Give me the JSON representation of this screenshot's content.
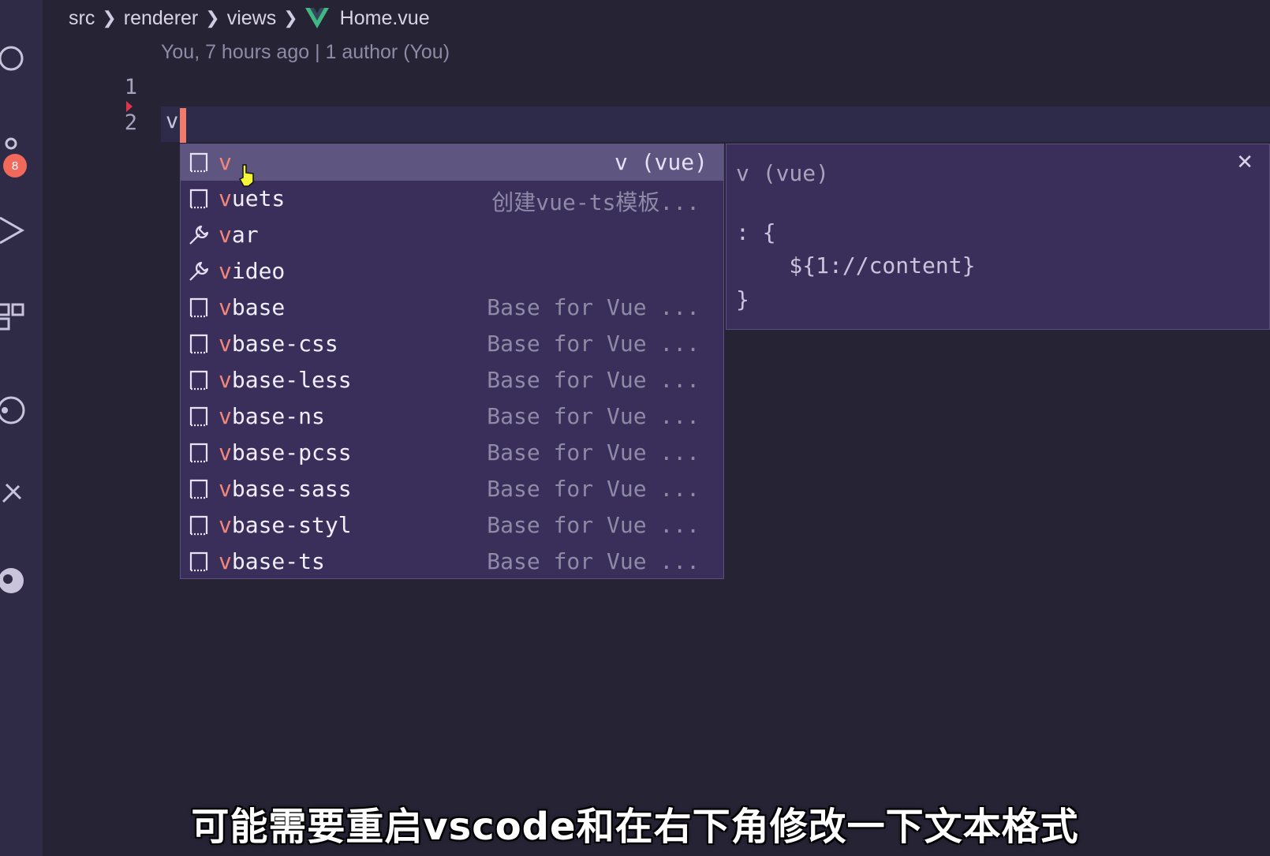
{
  "breadcrumb": {
    "items": [
      "src",
      "renderer",
      "views"
    ],
    "file": "Home.vue"
  },
  "codelens": "You, 7 hours ago | 1 author (You)",
  "editor": {
    "line_numbers": [
      "1",
      "2"
    ],
    "typed_text": "v"
  },
  "activity_bar": {
    "badge_count": "8"
  },
  "suggest": {
    "items": [
      {
        "icon": "snippet-icon",
        "rest": "",
        "detail": "v (vue)"
      },
      {
        "icon": "snippet-icon",
        "rest": "uets",
        "detail": "创建vue-ts模板..."
      },
      {
        "icon": "wrench-icon",
        "rest": "ar",
        "detail": ""
      },
      {
        "icon": "wrench-icon",
        "rest": "ideo",
        "detail": ""
      },
      {
        "icon": "snippet-icon",
        "rest": "base",
        "detail": "Base for Vue ..."
      },
      {
        "icon": "snippet-icon",
        "rest": "base-css",
        "detail": "Base for Vue ..."
      },
      {
        "icon": "snippet-icon",
        "rest": "base-less",
        "detail": "Base for Vue ..."
      },
      {
        "icon": "snippet-icon",
        "rest": "base-ns",
        "detail": "Base for Vue ..."
      },
      {
        "icon": "snippet-icon",
        "rest": "base-pcss",
        "detail": "Base for Vue ..."
      },
      {
        "icon": "snippet-icon",
        "rest": "base-sass",
        "detail": "Base for Vue ..."
      },
      {
        "icon": "snippet-icon",
        "rest": "base-styl",
        "detail": "Base for Vue ..."
      },
      {
        "icon": "snippet-icon",
        "rest": "base-ts",
        "detail": "Base for Vue ..."
      }
    ],
    "prefix": "v",
    "selected_index": 0
  },
  "details": {
    "title": "v (vue)",
    "lines": [
      ": {",
      "    ${1://content}",
      "}"
    ],
    "close_symbol": "✕"
  },
  "caption": "可能需要重启vscode和在右下角修改一下文本格式",
  "colors": {
    "accent": "#f28779",
    "background": "#262335",
    "widget": "#3a2f5a"
  }
}
